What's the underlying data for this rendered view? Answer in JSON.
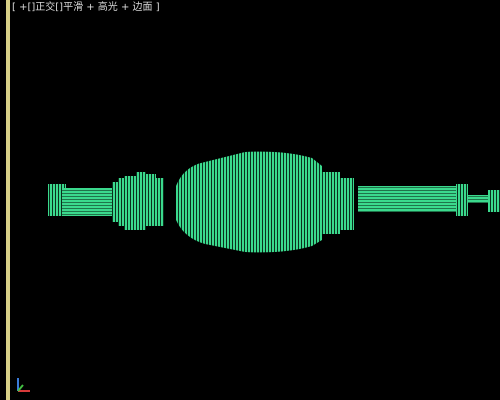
{
  "viewport": {
    "label": "[ +[]正交[]平滑 + 高光 + 边面 ]"
  },
  "colors": {
    "background": "#000000",
    "wire": "#3bd98d",
    "wire_dark": "#0b2f1d",
    "frame": "#d8cf86"
  },
  "icons": {
    "axis": "view-axis-icon"
  }
}
